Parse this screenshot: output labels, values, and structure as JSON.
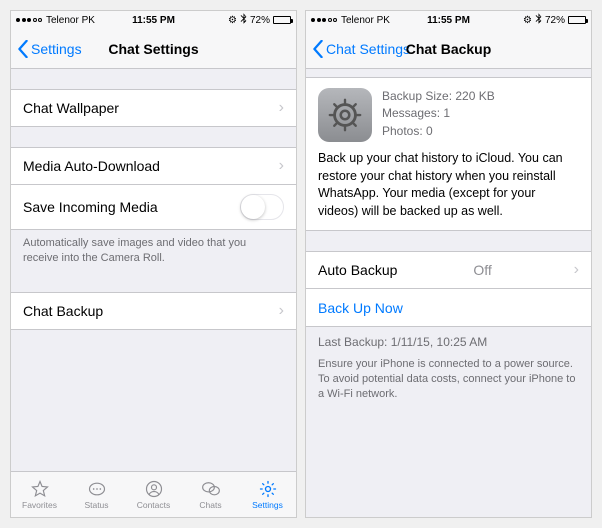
{
  "status": {
    "carrier": "Telenor PK",
    "time": "11:55 PM",
    "battery_pct": "72%"
  },
  "left": {
    "back": "Settings",
    "title": "Chat Settings",
    "rows": {
      "wallpaper": "Chat Wallpaper",
      "media_auto": "Media Auto-Download",
      "save_incoming": "Save Incoming Media",
      "save_footer": "Automatically save images and video that you receive into the Camera Roll.",
      "chat_backup": "Chat Backup"
    },
    "tabs": {
      "favorites": "Favorites",
      "status": "Status",
      "contacts": "Contacts",
      "chats": "Chats",
      "settings": "Settings"
    }
  },
  "right": {
    "back": "Chat Settings",
    "title": "Chat Backup",
    "meta": {
      "size_label": "Backup Size: 220 KB",
      "messages_label": "Messages: 1",
      "photos_label": "Photos: 0"
    },
    "desc": "Back up your chat history to iCloud. You can restore your chat history when you reinstall WhatsApp. Your media (except for your videos) will be backed up as well.",
    "auto_backup_label": "Auto Backup",
    "auto_backup_value": "Off",
    "backup_now": "Back Up Now",
    "last_backup": "Last Backup: 1/11/15, 10:25 AM",
    "footer": "Ensure your iPhone is connected to a power source. To avoid potential data costs, connect your iPhone to a Wi-Fi network."
  }
}
